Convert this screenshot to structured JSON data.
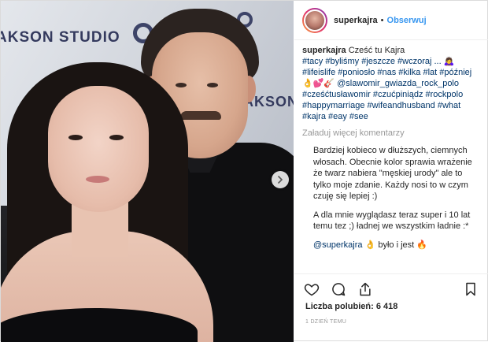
{
  "post": {
    "username": "superkajra",
    "follow_label": "Obserwuj",
    "separator": "•"
  },
  "photo": {
    "brand_left": "AKSON STUDIO",
    "brand_right": "AKSON"
  },
  "caption": {
    "username": "superkajra",
    "line1": "Cześć tu Kajra",
    "hashtags": "#tacy #byliśmy #jeszcze #wczoraj ... 🙇‍♀️ #lifeislife #poniosło #nas #kilka #lat #później 👌💕🎸 @slawomir_gwiazda_rock_polo #cześćtusławomir #czućpiniądz #rockpolo #happymarriage #wifeandhusband #what #kajra #eay #see"
  },
  "load_more": "Załaduj więcej komentarzy",
  "comments": [
    {
      "text": "Bardziej kobieco w dłuższych, ciemnych włosach. Obecnie kolor sprawia wrażenie że twarz nabiera \"męskiej urody\" ale to tylko moje zdanie. Każdy nosi to w czym czuję się lepiej :)"
    },
    {
      "text": "A dla mnie wyglądasz teraz super i 10 lat temu tez ;) ładnej we wszystkim ładnie :*"
    },
    {
      "mention": "@superkajra",
      "text": "👌 było i jest 🔥"
    }
  ],
  "likes": "Liczba polubień: 6 418",
  "timestamp": "1 DZIEŃ TEMU",
  "icons": {
    "like": "heart-icon",
    "comment": "comment-icon",
    "share": "share-icon",
    "save": "bookmark-icon",
    "next": "chevron-right-icon"
  },
  "colors": {
    "accent": "#3897f0",
    "hashtag": "#003569",
    "muted": "#999999"
  }
}
